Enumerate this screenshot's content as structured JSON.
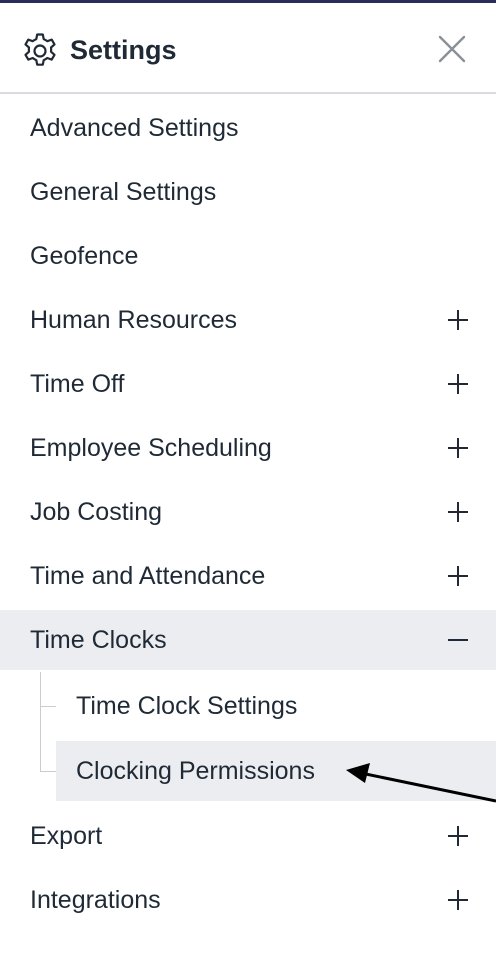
{
  "header": {
    "title": "Settings",
    "gear_icon": "gear-icon",
    "close_icon": "close-icon"
  },
  "menu": {
    "items": [
      {
        "label": "Advanced Settings",
        "expandable": false
      },
      {
        "label": "General Settings",
        "expandable": false
      },
      {
        "label": "Geofence",
        "expandable": false
      },
      {
        "label": "Human Resources",
        "expandable": true,
        "toggle": "+"
      },
      {
        "label": "Time Off",
        "expandable": true,
        "toggle": "+"
      },
      {
        "label": "Employee Scheduling",
        "expandable": true,
        "toggle": "+"
      },
      {
        "label": "Job Costing",
        "expandable": true,
        "toggle": "+"
      },
      {
        "label": "Time and Attendance",
        "expandable": true,
        "toggle": "+"
      },
      {
        "label": "Time Clocks",
        "expandable": true,
        "toggle": "−",
        "expanded": true
      },
      {
        "label": "Export",
        "expandable": true,
        "toggle": "+"
      },
      {
        "label": "Integrations",
        "expandable": true,
        "toggle": "+"
      }
    ],
    "time_clocks_submenu": [
      {
        "label": "Time Clock Settings"
      },
      {
        "label": "Clocking Permissions",
        "selected": true
      }
    ]
  },
  "colors": {
    "text": "#1f2a36",
    "active_background": "#ebedf0",
    "divider": "#d8dbe0",
    "top_border": "#2b2d5c"
  }
}
